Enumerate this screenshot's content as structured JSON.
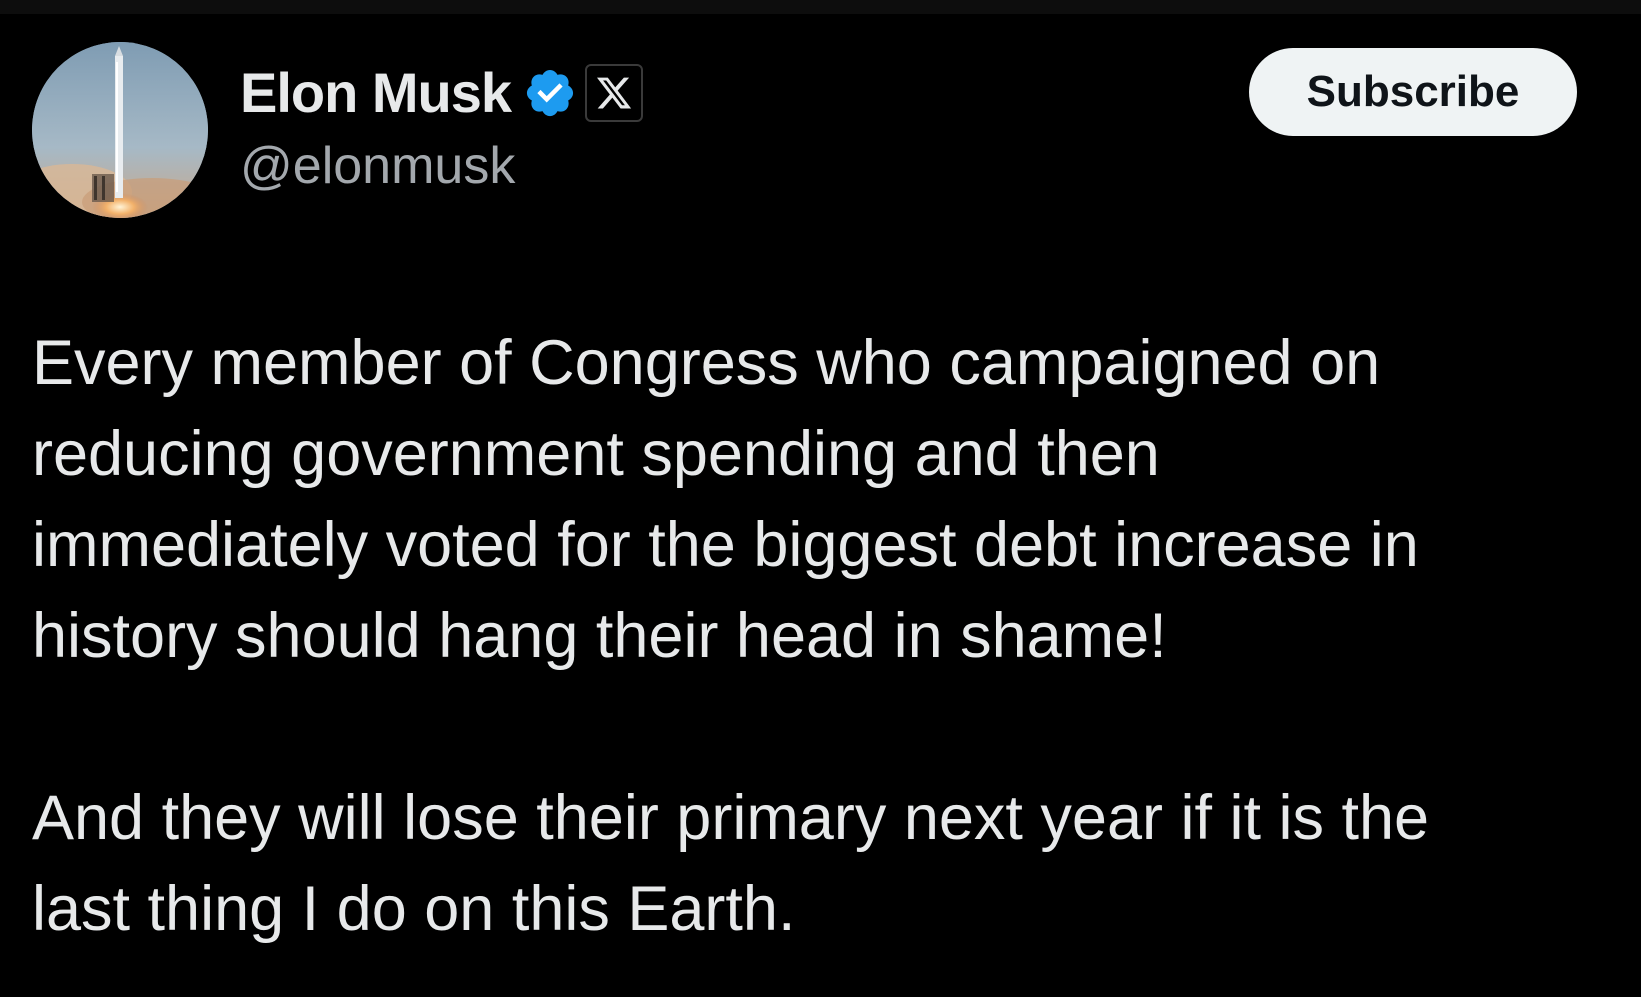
{
  "author": {
    "display_name": "Elon Musk",
    "handle": "@elonmusk",
    "verified_icon": "verified-badge-icon",
    "affiliation_icon": "x-logo-icon",
    "avatar": "rocket-launch-avatar"
  },
  "actions": {
    "subscribe_label": "Subscribe"
  },
  "tweet": {
    "paragraphs": [
      "Every member of Congress who campaigned on\nreducing government spending and then\nimmediately voted for the biggest debt increase in\nhistory should hang their head in shame!",
      "And they will lose their primary next year if it is the\nlast thing I do on this Earth."
    ]
  },
  "colors": {
    "background": "#000000",
    "text_primary": "#e7e9ea",
    "text_secondary": "#a3a8ad",
    "verified_blue": "#1d9bf0",
    "button_bg": "#eff3f4",
    "button_text": "#0f1419"
  }
}
